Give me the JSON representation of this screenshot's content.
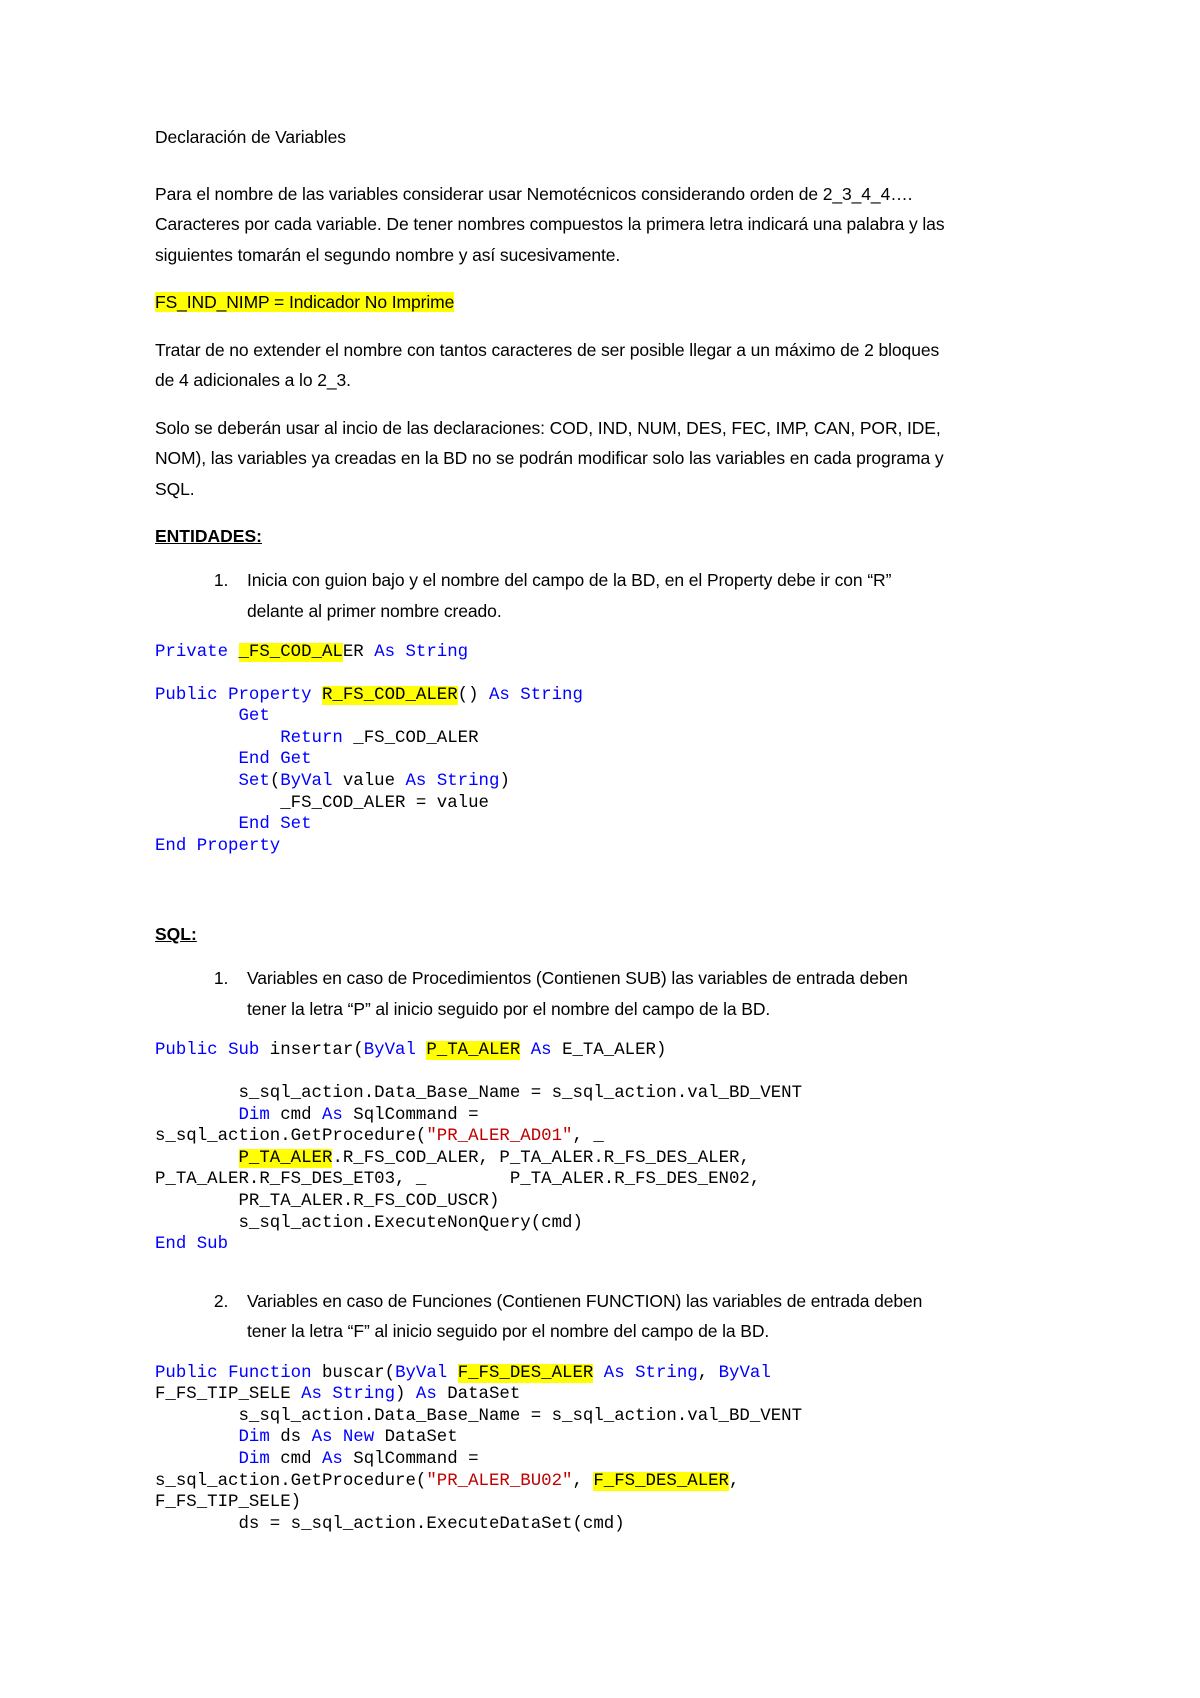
{
  "document": {
    "title": "Declaración de Variables",
    "paragraphs": {
      "intro": "Para el nombre de las variables considerar usar Nemotécnicos considerando orden de 2_3_4_4…. Caracteres por cada variable. De tener nombres compuestos la primera letra indicará una palabra y las siguientes tomarán el segundo nombre y así sucesivamente.",
      "highlight_example": "FS_IND_NIMP = Indicador No Imprime",
      "length_rule": "Tratar de no extender el nombre con tantos caracteres de ser posible llegar a un máximo de 2 bloques de 4 adicionales a lo 2_3.",
      "prefix_rule_a": "Solo se deberán usar al incio de las declaraciones: COD, IND, NUM, DES, FEC, IMP, CAN, POR, IDE, NOM), las variables ya creadas en la BD no se podrán modificar solo las variables en cada programa y SQL."
    },
    "sections": {
      "entidades": {
        "heading": "ENTIDADES:",
        "items": [
          "Inicia con guion bajo y el nombre del campo de la BD, en el Property debe ir con “R” delante al primer nombre creado."
        ]
      },
      "sql": {
        "heading": "SQL:",
        "items": [
          "Variables en caso de Procedimientos (Contienen SUB) las variables de entrada deben tener la letra “P” al inicio seguido por el nombre del campo de la BD.",
          "Variables en caso de Funciones (Contienen FUNCTION) las variables de entrada deben tener la letra “F” al inicio seguido por el nombre del campo de la BD."
        ]
      }
    },
    "code": {
      "entity_private": {
        "kw_private": "Private",
        "hl_var": "_FS_COD_AL",
        "var_tail": "ER",
        "kw_as": "As",
        "kw_string": "String"
      },
      "entity_property": {
        "l1_kw_public": "Public",
        "l1_kw_property": "Property",
        "l1_hl_name": "R_FS_COD_ALER",
        "l1_parens": "()",
        "l1_kw_as": "As",
        "l1_kw_string": "String",
        "l2_get": "Get",
        "l3_return": "Return",
        "l3_var": "_FS_COD_ALER",
        "l4_end_get": "End Get",
        "l5_set": "Set",
        "l5_paren_open": "(",
        "l5_byval": "ByVal",
        "l5_value": "value",
        "l5_as": "As",
        "l5_string": "String",
        "l5_paren_close": ")",
        "l6_assign": "_FS_COD_ALER = value",
        "l7_end_set": "End Set",
        "l8_end_property": "End Property"
      },
      "sql_sub": {
        "l1_public": "Public",
        "l1_sub": "Sub",
        "l1_name": " insertar(",
        "l1_byval": "ByVal",
        "l1_hl_param": "P_TA_ALER",
        "l1_as": "As",
        "l1_type": "E_TA_ALER)",
        "l2": "        s_sql_action.Data_Base_Name = s_sql_action.val_BD_VENT",
        "l3_dim": "Dim",
        "l3_cmd": " cmd ",
        "l3_as": "As",
        "l3_tail": " SqlCommand = ",
        "l4_pre": "s_sql_action.GetProcedure(",
        "l4_str": "\"PR_ALER_AD01\"",
        "l4_post": ", _",
        "l5_hl": "P_TA_ALER",
        "l5_post": ".R_FS_COD_ALER, P_TA_ALER.R_FS_DES_ALER,",
        "l6": "P_TA_ALER.R_FS_DES_ET03, _        P_TA_ALER.R_FS_DES_EN02,",
        "l7": "        PR_TA_ALER.R_FS_COD_USCR)",
        "l8": "        s_sql_action.ExecuteNonQuery(cmd)",
        "l9_end_sub": "End Sub"
      },
      "sql_function": {
        "l1_public": "Public",
        "l1_function": "Function",
        "l1_name": " buscar(",
        "l1_byval": "ByVal",
        "l1_hl_param": "F_FS_DES_ALER",
        "l1_as": "As",
        "l1_string": "String",
        "l1_comma": ", ",
        "l1_byval2": "ByVal",
        "l2_pre": "F_FS_TIP_SELE ",
        "l2_as": "As",
        "l2_string": "String",
        "l2_mid": ") ",
        "l2_as2": "As",
        "l2_tail": " DataSet",
        "l3": "        s_sql_action.Data_Base_Name = s_sql_action.val_BD_VENT",
        "l4_dim": "Dim",
        "l4_ds": " ds ",
        "l4_as": "As",
        "l4_new": "New",
        "l4_tail": " DataSet",
        "l5_dim": "Dim",
        "l5_cmd": " cmd ",
        "l5_as": "As",
        "l5_tail": " SqlCommand = ",
        "l6_pre": "s_sql_action.GetProcedure(",
        "l6_str": "\"PR_ALER_BU02\"",
        "l6_mid": ", ",
        "l6_hl": "F_FS_DES_ALER",
        "l6_post": ",",
        "l7": "F_FS_TIP_SELE)",
        "l8": "        ds = s_sql_action.ExecuteDataSet(cmd)"
      }
    },
    "colors": {
      "highlight": "#ffff00",
      "keyword": "#0000ff",
      "string": "#c00000",
      "text": "#000000",
      "page_background": "#ffffff"
    }
  }
}
